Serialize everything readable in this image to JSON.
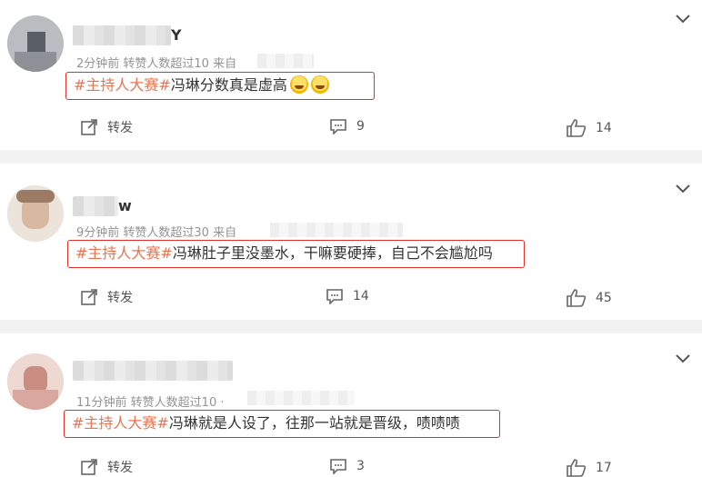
{
  "posts": [
    {
      "username_suffix": "Y",
      "meta": "2分钟前 转赞人数超过10 来自",
      "hashtag": "#主持人大赛#",
      "text": "冯琳分数真是虚高",
      "emoji": [
        "laugh-cry-emoji",
        "laugh-cry-emoji"
      ],
      "repost_label": "转发",
      "comment_count": "9",
      "like_count": "14"
    },
    {
      "username_suffix": "w",
      "meta": "9分钟前 转赞人数超过30 来自",
      "hashtag": "#主持人大赛#",
      "text": "冯琳肚子里没墨水，干嘛要硬捧，自己不会尴尬吗",
      "emoji": [],
      "repost_label": "转发",
      "comment_count": "14",
      "like_count": "45"
    },
    {
      "username_suffix": "",
      "meta": "11分钟前 转赞人数超过10 ·",
      "hashtag": "#主持人大赛#",
      "text": "冯琳就是人设了，往那一站就是晋级，啧啧啧",
      "emoji": [],
      "repost_label": "转发",
      "comment_count": "3",
      "like_count": "17"
    }
  ],
  "colors": {
    "hashtag": "#eb7350",
    "highlight_box": "#e0302a",
    "meta": "#939393",
    "divider": "#f2f2f2"
  }
}
